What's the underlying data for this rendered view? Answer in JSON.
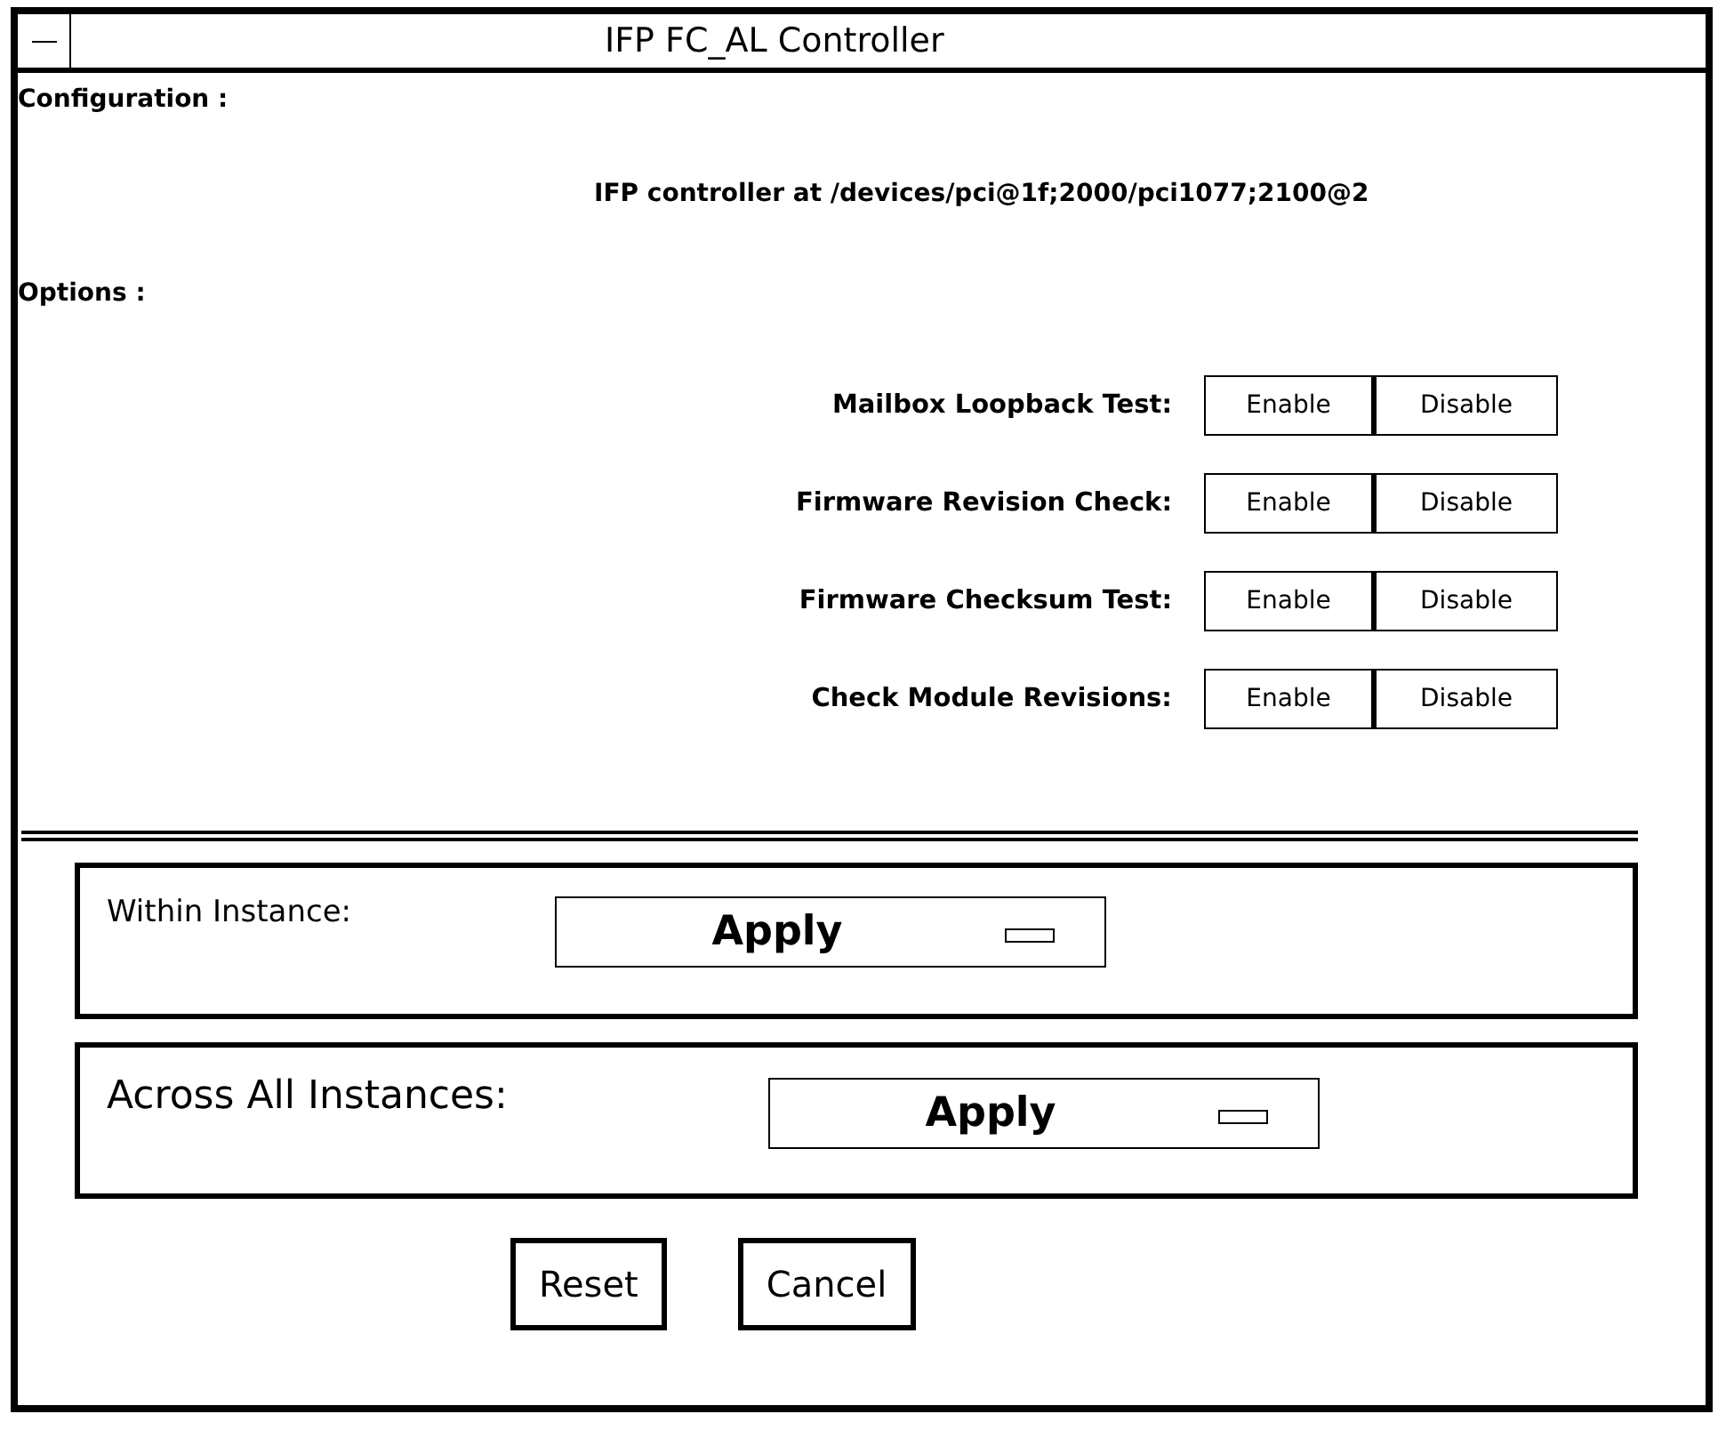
{
  "window": {
    "title": "IFP FC_AL Controller"
  },
  "configuration": {
    "label": "Configuration :",
    "value": "IFP controller at /devices/pci@1f;2000/pci1077;2100@2"
  },
  "options": {
    "label": "Options :",
    "items": [
      {
        "label": "Mailbox Loopback Test:",
        "buttons": [
          "Enable",
          "Disable"
        ]
      },
      {
        "label": "Firmware Revision Check:",
        "buttons": [
          "Enable",
          "Disable"
        ]
      },
      {
        "label": "Firmware Checksum Test:",
        "buttons": [
          "Enable",
          "Disable"
        ]
      },
      {
        "label": "Check Module Revisions:",
        "buttons": [
          "Enable",
          "Disable"
        ]
      }
    ]
  },
  "scopes": [
    {
      "kind": "small",
      "label": "Within Instance:",
      "menu": "Apply"
    },
    {
      "kind": "large",
      "label": "Across All Instances:",
      "menu": "Apply"
    }
  ],
  "buttons": [
    "Reset",
    "Cancel"
  ]
}
